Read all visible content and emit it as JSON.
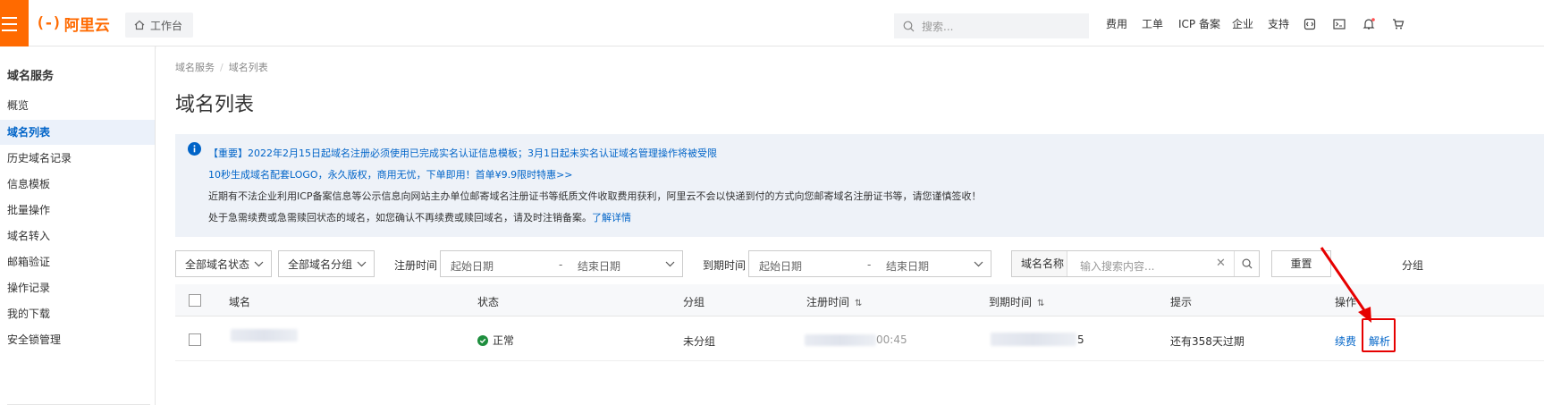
{
  "header": {
    "logo_text": "阿里云",
    "logo_mark": "(-)",
    "workbench_label": "工作台",
    "search_placeholder": "搜索...",
    "nav": [
      "费用",
      "工单",
      "ICP 备案",
      "企业",
      "支持"
    ],
    "icons": [
      "terminal-code-icon",
      "console-icon",
      "bell-icon",
      "cart-icon"
    ],
    "accent_color": "#ff6a00"
  },
  "sidebar": {
    "title": "域名服务",
    "items": [
      {
        "label": "概览",
        "active": false
      },
      {
        "label": "域名列表",
        "active": true
      },
      {
        "label": "历史域名记录",
        "active": false
      },
      {
        "label": "信息模板",
        "active": false
      },
      {
        "label": "批量操作",
        "active": false
      },
      {
        "label": "域名转入",
        "active": false
      },
      {
        "label": "邮箱验证",
        "active": false
      },
      {
        "label": "操作记录",
        "active": false
      },
      {
        "label": "我的下载",
        "active": false
      },
      {
        "label": "安全锁管理",
        "active": false
      }
    ]
  },
  "main": {
    "breadcrumb": [
      "域名服务",
      "域名列表"
    ],
    "breadcrumb_sep": "/",
    "title": "域名列表",
    "notice": {
      "line1_tag": "【重要】",
      "line1_text": "2022年2月15日起域名注册必须使用已完成实名认证信息模板；3月1日起未实名认证域名管理操作将被受限",
      "line2": "10秒生成域名配套LOGO，永久版权，商用无忧，下单即用！首单¥9.9限时特惠>>",
      "line3": "近期有不法企业利用ICP备案信息等公示信息向网站主办单位邮寄域名注册证书等纸质文件收取费用获利，阿里云不会以快递到付的方式向您邮寄域名注册证书等，请您谨慎签收！",
      "line4_text": "处于急需续费或急需赎回状态的域名，如您确认不再续费或赎回域名，请及时注销备案。",
      "line4_link": "了解详情"
    },
    "filters": {
      "status_select": "全部域名状态",
      "group_select": "全部域名分组",
      "reg_time_label": "注册时间",
      "expire_time_label": "到期时间",
      "start_placeholder": "起始日期",
      "end_placeholder": "结束日期",
      "range_sep": "-",
      "search_kind": "域名名称",
      "search_placeholder": "输入搜索内容...",
      "reset_label": "重置",
      "group_label": "分组"
    },
    "table": {
      "headers": [
        "域名",
        "状态",
        "分组",
        "注册时间",
        "到期时间",
        "提示",
        "操作"
      ],
      "sort_icon": "⇅",
      "rows": [
        {
          "status": "正常",
          "group": "未分组",
          "reg_time_partial": "00:45",
          "expire_time_partial": "5",
          "hint": "还有358天过期",
          "actions": [
            "续费",
            "解析"
          ]
        }
      ]
    }
  }
}
